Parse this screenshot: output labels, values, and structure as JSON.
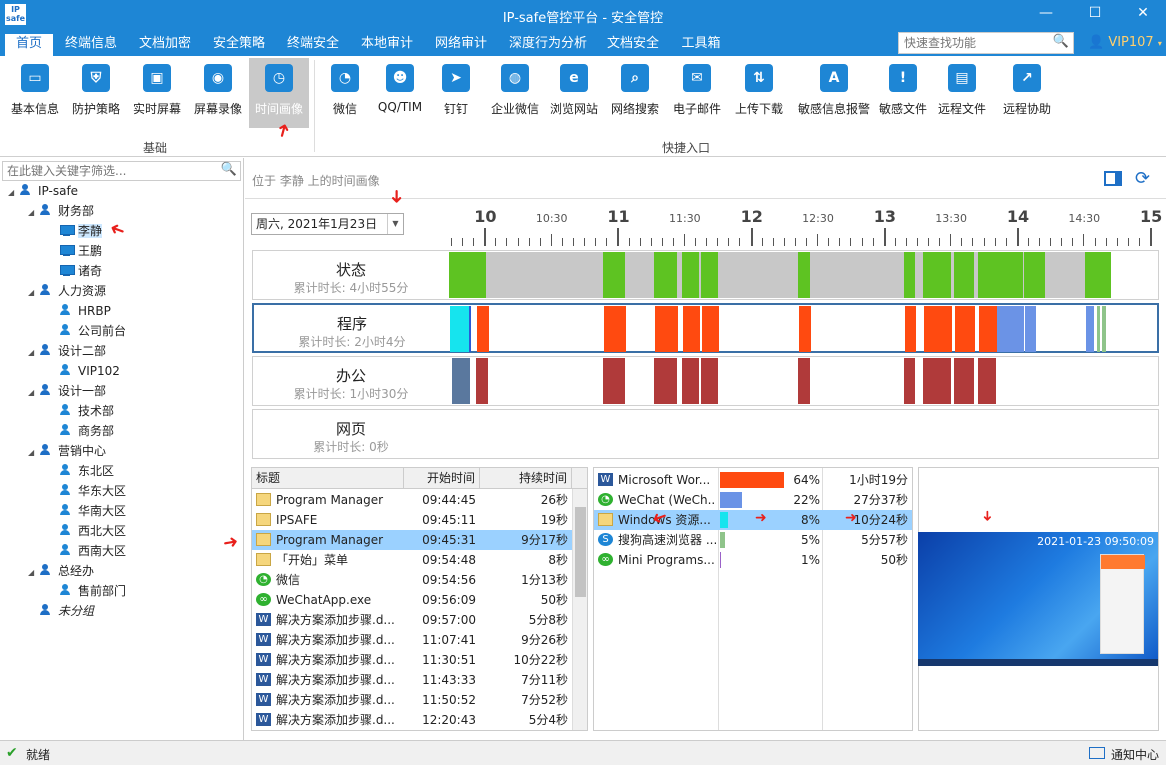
{
  "window": {
    "logo_text": "IP-safe",
    "title": "IP-safe管控平台 - 安全管控",
    "minimize": "—",
    "maximize": "☐",
    "close": "✕"
  },
  "menu": {
    "items": [
      "首页",
      "终端信息",
      "文档加密",
      "安全策略",
      "终端安全",
      "本地审计",
      "网络审计",
      "深度行为分析",
      "文档安全",
      "工具箱"
    ],
    "active": "首页"
  },
  "search": {
    "placeholder": "快速查找功能"
  },
  "user": {
    "label": "VIP107"
  },
  "ribbon": {
    "basic": [
      {
        "label": "基本信息",
        "icon": "monitor-info-icon",
        "color": "#1e86d5"
      },
      {
        "label": "防护策略",
        "icon": "shield-policy-icon",
        "color": "#1e86d5"
      },
      {
        "label": "实时屏幕",
        "icon": "live-screen-icon",
        "color": "#1e86d5"
      },
      {
        "label": "屏幕录像",
        "icon": "screen-record-icon",
        "color": "#1e86d5"
      },
      {
        "label": "时间画像",
        "icon": "clock-icon",
        "color": "#1e86d5"
      }
    ],
    "basic_group": "基础",
    "quick": [
      {
        "label": "微信",
        "icon": "wechat-icon",
        "color": "#1e86d5"
      },
      {
        "label": "QQ/TIM",
        "icon": "qq-icon",
        "color": "#1e86d5"
      },
      {
        "label": "钉钉",
        "icon": "dingtalk-icon",
        "color": "#1e86d5"
      },
      {
        "label": "企业微信",
        "icon": "wecom-icon",
        "color": "#1e86d5"
      },
      {
        "label": "浏览网站",
        "icon": "browser-icon",
        "color": "#1e86d5"
      },
      {
        "label": "网络搜索",
        "icon": "web-search-icon",
        "color": "#1e86d5"
      },
      {
        "label": "电子邮件",
        "icon": "email-icon",
        "color": "#1e86d5"
      },
      {
        "label": "上传下载",
        "icon": "upload-download-icon",
        "color": "#1e86d5"
      },
      {
        "label": "敏感信息报警",
        "icon": "sensitive-alert-icon",
        "color": "#1e86d5"
      },
      {
        "label": "敏感文件",
        "icon": "sensitive-file-icon",
        "color": "#1e86d5"
      },
      {
        "label": "远程文件",
        "icon": "remote-file-icon",
        "color": "#1e86d5"
      },
      {
        "label": "远程协助",
        "icon": "remote-assist-icon",
        "color": "#1e86d5"
      }
    ],
    "quick_group": "快捷入口"
  },
  "tree": {
    "filter_placeholder": "在此键入关键字筛选...",
    "nodes": [
      {
        "label": "IP-safe",
        "type": "group",
        "level": 0,
        "expanded": true
      },
      {
        "label": "财务部",
        "type": "group",
        "level": 1,
        "expanded": true
      },
      {
        "label": "李静",
        "type": "pc",
        "level": 2,
        "selected": true
      },
      {
        "label": "王鹏",
        "type": "pc",
        "level": 2
      },
      {
        "label": "诸奇",
        "type": "pc",
        "level": 2
      },
      {
        "label": "人力资源",
        "type": "group",
        "level": 1,
        "expanded": true
      },
      {
        "label": "HRBP",
        "type": "user",
        "level": 2
      },
      {
        "label": "公司前台",
        "type": "user",
        "level": 2
      },
      {
        "label": "设计二部",
        "type": "group",
        "level": 1,
        "expanded": true
      },
      {
        "label": "VIP102",
        "type": "user",
        "level": 2
      },
      {
        "label": "设计一部",
        "type": "group",
        "level": 1,
        "expanded": true
      },
      {
        "label": "技术部",
        "type": "user",
        "level": 2
      },
      {
        "label": "商务部",
        "type": "user",
        "level": 2
      },
      {
        "label": "营销中心",
        "type": "group",
        "level": 1,
        "expanded": true
      },
      {
        "label": "东北区",
        "type": "user",
        "level": 2
      },
      {
        "label": "华东大区",
        "type": "user",
        "level": 2
      },
      {
        "label": "华南大区",
        "type": "user",
        "level": 2
      },
      {
        "label": "西北大区",
        "type": "user",
        "level": 2
      },
      {
        "label": "西南大区",
        "type": "user",
        "level": 2
      },
      {
        "label": "总经办",
        "type": "group",
        "level": 1,
        "expanded": true
      },
      {
        "label": "售前部门",
        "type": "user",
        "level": 2
      },
      {
        "label": "未分组",
        "type": "group",
        "level": 1,
        "italic": true
      }
    ]
  },
  "location": "位于 李静 上的时间画像",
  "date": {
    "value": "周六, 2021年1月23日",
    "dropdown": "▼"
  },
  "timeline": {
    "start_hour": 9.72,
    "end_hour": 15.0,
    "major_labels": [
      "10",
      "11",
      "12",
      "13",
      "14",
      "15"
    ],
    "minor_labels": [
      "10:30",
      "11:30",
      "12:30",
      "13:30",
      "14:30"
    ],
    "rows": [
      {
        "name": "状态",
        "duration": "累计时长: 4小时55分",
        "selected": false,
        "segments": [
          {
            "start": 9.72,
            "end": 10.0,
            "color": "#5ec322"
          },
          {
            "start": 10.0,
            "end": 10.88,
            "color": "#c8c8c8"
          },
          {
            "start": 10.88,
            "end": 11.04,
            "color": "#5ec322"
          },
          {
            "start": 11.04,
            "end": 11.26,
            "color": "#c8c8c8"
          },
          {
            "start": 11.26,
            "end": 11.43,
            "color": "#5ec322"
          },
          {
            "start": 11.43,
            "end": 11.47,
            "color": "#c8c8c8"
          },
          {
            "start": 11.47,
            "end": 11.6,
            "color": "#5ec322"
          },
          {
            "start": 11.6,
            "end": 11.61,
            "color": "#c8c8c8"
          },
          {
            "start": 11.61,
            "end": 11.74,
            "color": "#5ec322"
          },
          {
            "start": 11.74,
            "end": 12.34,
            "color": "#c8c8c8"
          },
          {
            "start": 12.34,
            "end": 12.43,
            "color": "#5ec322"
          },
          {
            "start": 12.43,
            "end": 13.14,
            "color": "#c8c8c8"
          },
          {
            "start": 13.14,
            "end": 13.22,
            "color": "#5ec322"
          },
          {
            "start": 13.22,
            "end": 13.28,
            "color": "#c8c8c8"
          },
          {
            "start": 13.28,
            "end": 13.49,
            "color": "#5ec322"
          },
          {
            "start": 13.49,
            "end": 13.51,
            "color": "#c8c8c8"
          },
          {
            "start": 13.51,
            "end": 13.66,
            "color": "#5ec322"
          },
          {
            "start": 13.66,
            "end": 13.69,
            "color": "#c8c8c8"
          },
          {
            "start": 13.69,
            "end": 14.03,
            "color": "#5ec322"
          },
          {
            "start": 14.03,
            "end": 14.04,
            "color": "#c8c8c8"
          },
          {
            "start": 14.04,
            "end": 14.2,
            "color": "#5ec322"
          },
          {
            "start": 14.2,
            "end": 14.5,
            "color": "#c8c8c8"
          },
          {
            "start": 14.5,
            "end": 14.69,
            "color": "#5ec322"
          }
        ]
      },
      {
        "name": "程序",
        "duration": "累计时长: 2小时4分",
        "selected": true,
        "segments": [
          {
            "start": 9.72,
            "end": 9.86,
            "color": "#16e4ee"
          },
          {
            "start": 9.86,
            "end": 9.88,
            "color": "#2a5bd7"
          },
          {
            "start": 9.92,
            "end": 10.01,
            "color": "#ff4a10"
          },
          {
            "start": 10.88,
            "end": 11.04,
            "color": "#ff4a10"
          },
          {
            "start": 11.26,
            "end": 11.43,
            "color": "#ff4a10"
          },
          {
            "start": 11.47,
            "end": 11.6,
            "color": "#ff4a10"
          },
          {
            "start": 11.61,
            "end": 11.74,
            "color": "#ff4a10"
          },
          {
            "start": 12.34,
            "end": 12.43,
            "color": "#ff4a10"
          },
          {
            "start": 13.14,
            "end": 13.22,
            "color": "#ff4a10"
          },
          {
            "start": 13.28,
            "end": 13.49,
            "color": "#ff4a10"
          },
          {
            "start": 13.51,
            "end": 13.66,
            "color": "#ff4a10"
          },
          {
            "start": 13.69,
            "end": 13.83,
            "color": "#ff4a10"
          },
          {
            "start": 13.83,
            "end": 14.03,
            "color": "#6b93e6"
          },
          {
            "start": 14.04,
            "end": 14.12,
            "color": "#6b93e6"
          },
          {
            "start": 14.5,
            "end": 14.56,
            "color": "#6b93e6"
          },
          {
            "start": 14.58,
            "end": 14.6,
            "color": "#8fc48a"
          },
          {
            "start": 14.62,
            "end": 14.65,
            "color": "#8fc48a"
          }
        ]
      },
      {
        "name": "办公",
        "duration": "累计时长: 1小时30分",
        "selected": false,
        "segments": [
          {
            "start": 9.74,
            "end": 9.88,
            "color": "#5a789e"
          },
          {
            "start": 9.92,
            "end": 10.01,
            "color": "#b03a3a"
          },
          {
            "start": 10.88,
            "end": 11.04,
            "color": "#b03a3a"
          },
          {
            "start": 11.26,
            "end": 11.43,
            "color": "#b03a3a"
          },
          {
            "start": 11.47,
            "end": 11.6,
            "color": "#b03a3a"
          },
          {
            "start": 11.61,
            "end": 11.74,
            "color": "#b03a3a"
          },
          {
            "start": 12.34,
            "end": 12.43,
            "color": "#b03a3a"
          },
          {
            "start": 13.14,
            "end": 13.22,
            "color": "#b03a3a"
          },
          {
            "start": 13.28,
            "end": 13.49,
            "color": "#b03a3a"
          },
          {
            "start": 13.51,
            "end": 13.66,
            "color": "#b03a3a"
          },
          {
            "start": 13.69,
            "end": 13.83,
            "color": "#b03a3a"
          }
        ]
      },
      {
        "name": "网页",
        "duration": "累计时长: 0秒",
        "selected": false,
        "segments": []
      }
    ]
  },
  "events": {
    "headers": [
      "标题",
      "开始时间",
      "持续时间"
    ],
    "rows": [
      {
        "icon": "folder",
        "title": "Program Manager",
        "start": "09:44:45",
        "dur": "26秒"
      },
      {
        "icon": "folder",
        "title": "IPSAFE",
        "start": "09:45:11",
        "dur": "19秒"
      },
      {
        "icon": "folder",
        "title": "Program Manager",
        "start": "09:45:31",
        "dur": "9分17秒",
        "selected": true
      },
      {
        "icon": "folder",
        "title": "「开始」菜单",
        "start": "09:54:48",
        "dur": "8秒"
      },
      {
        "icon": "wechat",
        "title": "微信",
        "start": "09:54:56",
        "dur": "1分13秒"
      },
      {
        "icon": "miniapp",
        "title": "WeChatApp.exe",
        "start": "09:56:09",
        "dur": "50秒"
      },
      {
        "icon": "word",
        "title": "解决方案添加步骤.d...",
        "start": "09:57:00",
        "dur": "5分8秒"
      },
      {
        "icon": "word",
        "title": "解决方案添加步骤.d...",
        "start": "11:07:41",
        "dur": "9分26秒"
      },
      {
        "icon": "word",
        "title": "解决方案添加步骤.d...",
        "start": "11:30:51",
        "dur": "10分22秒"
      },
      {
        "icon": "word",
        "title": "解决方案添加步骤.d...",
        "start": "11:43:33",
        "dur": "7分11秒"
      },
      {
        "icon": "word",
        "title": "解决方案添加步骤.d...",
        "start": "11:50:52",
        "dur": "7分52秒"
      },
      {
        "icon": "word",
        "title": "解决方案添加步骤.d...",
        "start": "12:20:43",
        "dur": "5分4秒"
      }
    ]
  },
  "apps": {
    "rows": [
      {
        "icon": "word",
        "name": "Microsoft Wor...",
        "pct": "64%",
        "pct_value": 64,
        "time": "1小时19分",
        "bar_color": "#ff4a10"
      },
      {
        "icon": "wechat",
        "name": "WeChat (WeCh...",
        "pct": "22%",
        "pct_value": 22,
        "time": "27分37秒",
        "bar_color": "#6b93e6"
      },
      {
        "icon": "folder",
        "name": "Windows 资源...",
        "pct": "8%",
        "pct_value": 8,
        "time": "10分24秒",
        "bar_color": "#16e4ee",
        "selected": true
      },
      {
        "icon": "sogou",
        "name": "搜狗高速浏览器 ...",
        "pct": "5%",
        "pct_value": 5,
        "time": "5分57秒",
        "bar_color": "#8fc48a"
      },
      {
        "icon": "miniapp",
        "name": "Mini Programs...",
        "pct": "1%",
        "pct_value": 1,
        "time": "50秒",
        "bar_color": "#9a62c8"
      }
    ]
  },
  "screenshot": {
    "timestamp": "2021-01-23 09:50:09"
  },
  "status": {
    "text": "就绪",
    "ok_icon": "✔",
    "notify": "通知中心"
  },
  "colors": {
    "accent": "#1e86d5",
    "selection": "#9bd1ff",
    "annotation": "#e8201c"
  }
}
